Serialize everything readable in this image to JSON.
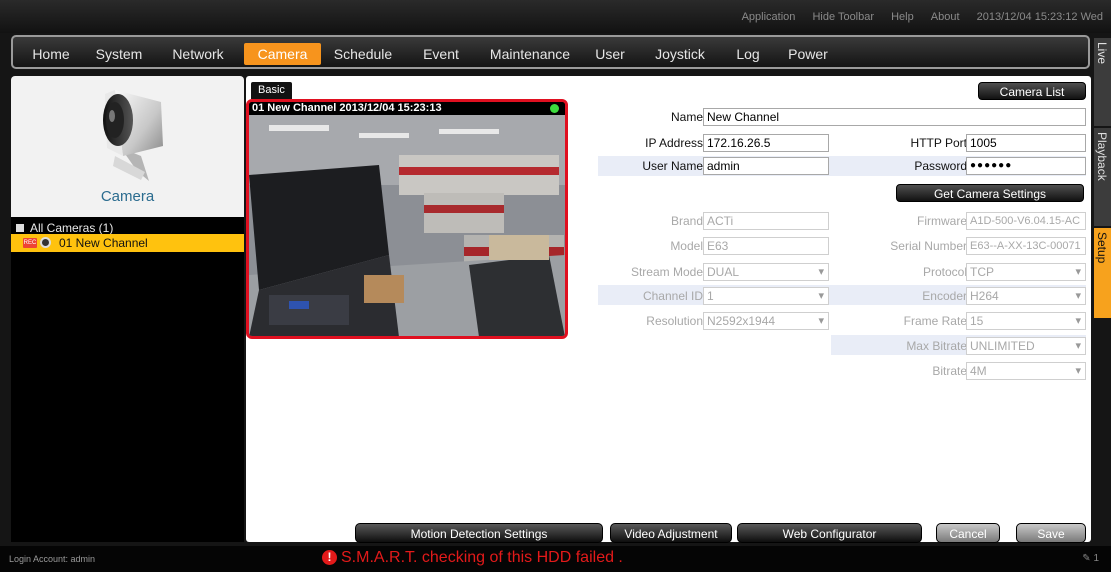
{
  "toplinks": [
    "Application",
    "Hide Toolbar",
    "Help",
    "About",
    "2013/12/04 15:23:12 Wed"
  ],
  "menu": [
    "Home",
    "System",
    "Network",
    "Camera",
    "Schedule",
    "Event",
    "Maintenance",
    "User",
    "Joystick",
    "Log",
    "Power"
  ],
  "menu_active": "Camera",
  "sidetabs": [
    "Live",
    "Playback",
    "Setup"
  ],
  "sidetab_active": "Setup",
  "left": {
    "caption": "Camera",
    "tree_root": "All Cameras (1)",
    "rec_badge": "REC",
    "channel": "01  New Channel"
  },
  "tab": "Basic",
  "camera_list_button": "Camera List",
  "video": {
    "overlay": "01 New Channel   2013/12/04 15:23:13"
  },
  "form": {
    "name_label": "Name",
    "name": "New Channel",
    "ip_label": "IP Address",
    "ip": "172.16.26.5",
    "http_port_label": "HTTP Port",
    "http_port": "1005",
    "user_label": "User Name",
    "user": "admin",
    "password_label": "Password",
    "password": "●●●●●●",
    "get_settings": "Get Camera Settings",
    "brand_label": "Brand",
    "brand": "ACTi",
    "firmware_label": "Firmware",
    "firmware": "A1D-500-V6.04.15-AC",
    "model_label": "Model",
    "model": "E63",
    "serial_label": "Serial Number",
    "serial": "E63--A-XX-13C-00071",
    "stream_mode_label": "Stream Mode",
    "stream_mode": "DUAL",
    "protocol_label": "Protocol",
    "protocol": "TCP",
    "channel_id_label": "Channel ID",
    "channel_id": "1",
    "encoder_label": "Encoder",
    "encoder": "H264",
    "resolution_label": "Resolution",
    "resolution": "N2592x1944",
    "frame_rate_label": "Frame Rate",
    "frame_rate": "15",
    "max_bitrate_label": "Max Bitrate",
    "max_bitrate": "UNLIMITED",
    "bitrate_label": "Bitrate",
    "bitrate": "4M"
  },
  "buttons": {
    "motion": "Motion Detection Settings",
    "video_adj": "Video Adjustment",
    "web_config": "Web Configurator",
    "cancel": "Cancel",
    "save": "Save"
  },
  "status": {
    "login": "Login Account: admin",
    "alert_mark": "!",
    "alert": "S.M.A.R.T. checking of this HDD failed .",
    "count": "1"
  }
}
